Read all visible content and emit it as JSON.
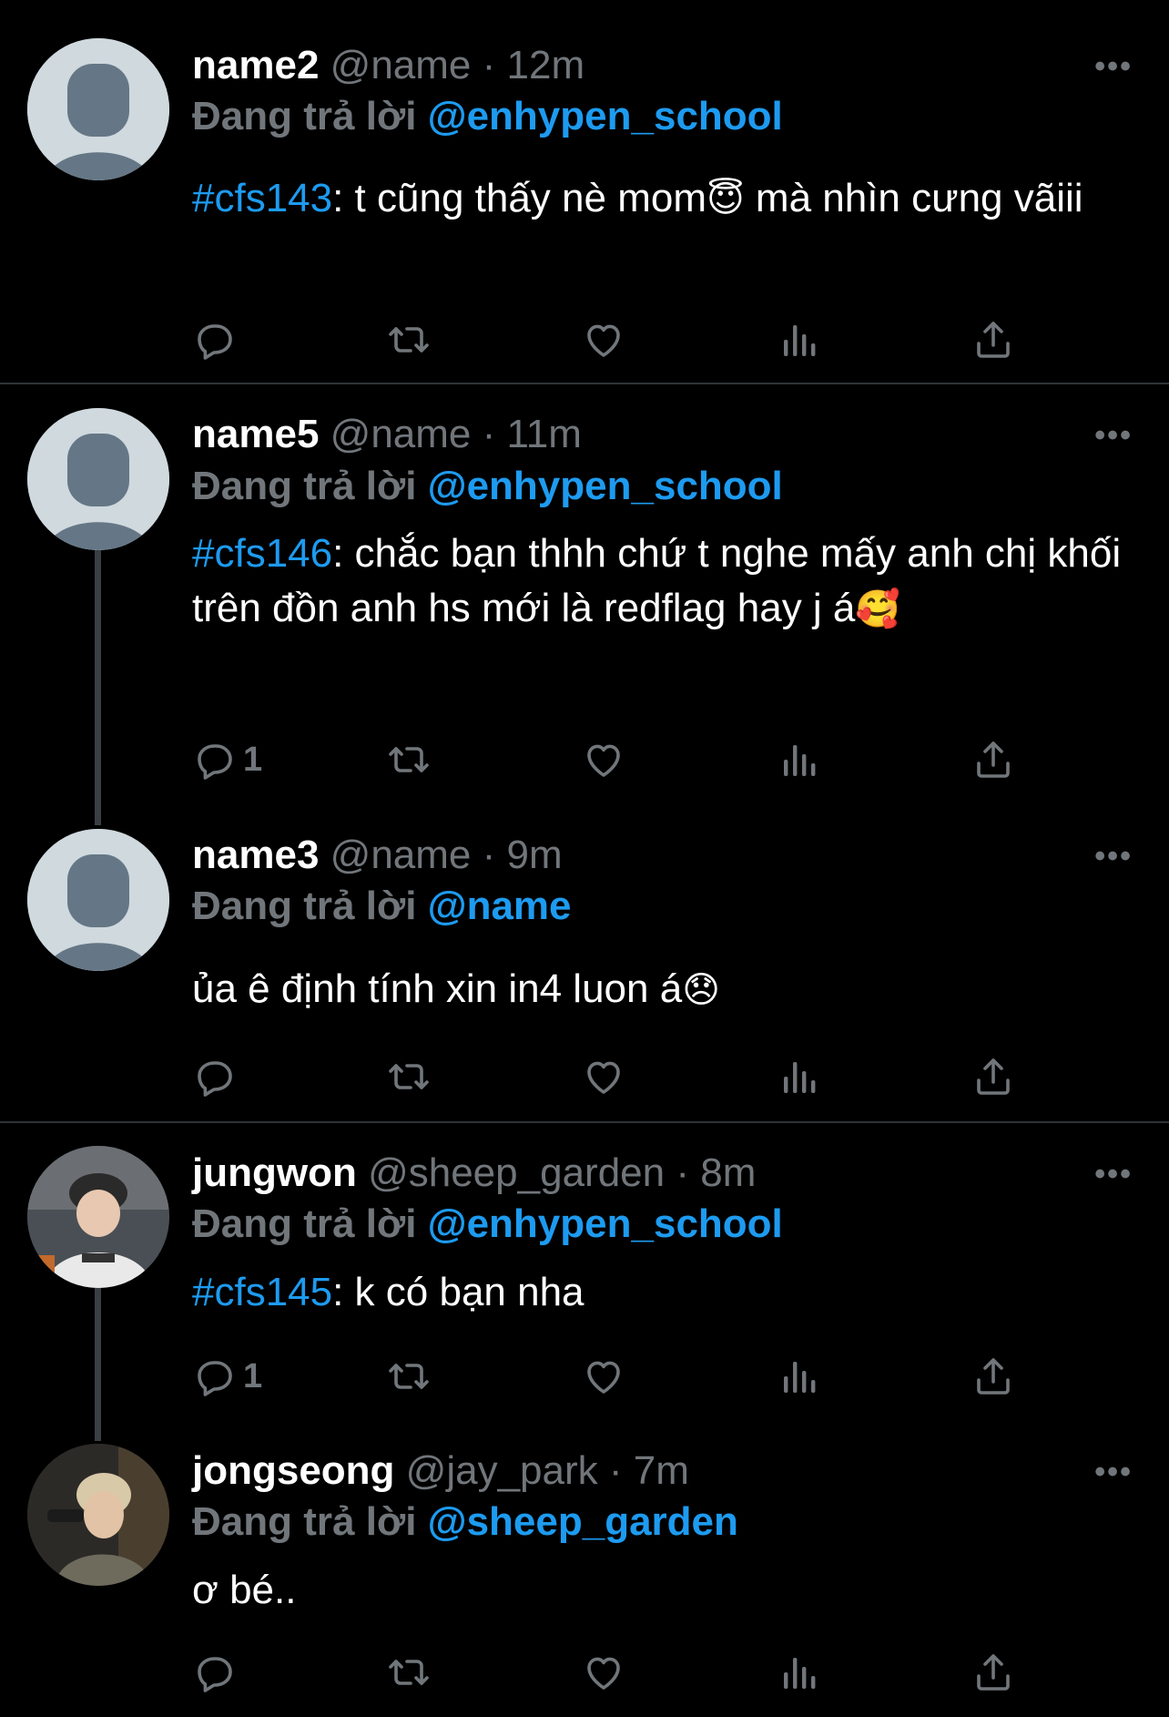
{
  "tweets": [
    {
      "name": "name2",
      "handle": "@name",
      "time": "12m",
      "replying_label": "Đang trả lời",
      "replying_to": "@enhypen_school",
      "hashtag": "#cfs143",
      "text": ": t cũng thấy nè mom",
      "emoji": "😇",
      "text_after": "  mà nhìn cưng vãiii",
      "reply_count": ""
    },
    {
      "name": "name5",
      "handle": "@name",
      "time": "11m",
      "replying_label": "Đang trả lời",
      "replying_to": "@enhypen_school",
      "hashtag": "#cfs146",
      "text": ": chắc bạn thhh chứ t nghe mấy anh chị khối trên đồn anh hs mới là redflag hay j á",
      "emoji": "🥰",
      "text_after": "",
      "reply_count": "1"
    },
    {
      "name": "name3",
      "handle": "@name",
      "time": "9m",
      "replying_label": "Đang trả lời",
      "replying_to": "@name",
      "hashtag": "",
      "text": "ủa ê định tính xin in4 luon á",
      "emoji": "😞",
      "text_after": "",
      "reply_count": ""
    },
    {
      "name": "jungwon",
      "handle": "@sheep_garden",
      "time": "8m",
      "replying_label": "Đang trả lời",
      "replying_to": "@enhypen_school",
      "hashtag": "#cfs145",
      "text": ": k có bạn nha",
      "emoji": "",
      "text_after": "",
      "reply_count": "1"
    },
    {
      "name": "jongseong",
      "handle": "@jay_park",
      "time": "7m",
      "replying_label": "Đang trả lời",
      "replying_to": "@sheep_garden",
      "hashtag": "",
      "text": "ơ bé..",
      "emoji": "",
      "text_after": "",
      "reply_count": ""
    }
  ],
  "separator": "·",
  "icons": {
    "more": "more-horizontal-icon",
    "reply": "reply-icon",
    "retweet": "retweet-icon",
    "like": "heart-icon",
    "views": "views-icon",
    "share": "share-icon"
  },
  "colors": {
    "background": "#000000",
    "accent": "#1d9bf0",
    "muted": "#71767b",
    "divider": "#2f3336"
  }
}
